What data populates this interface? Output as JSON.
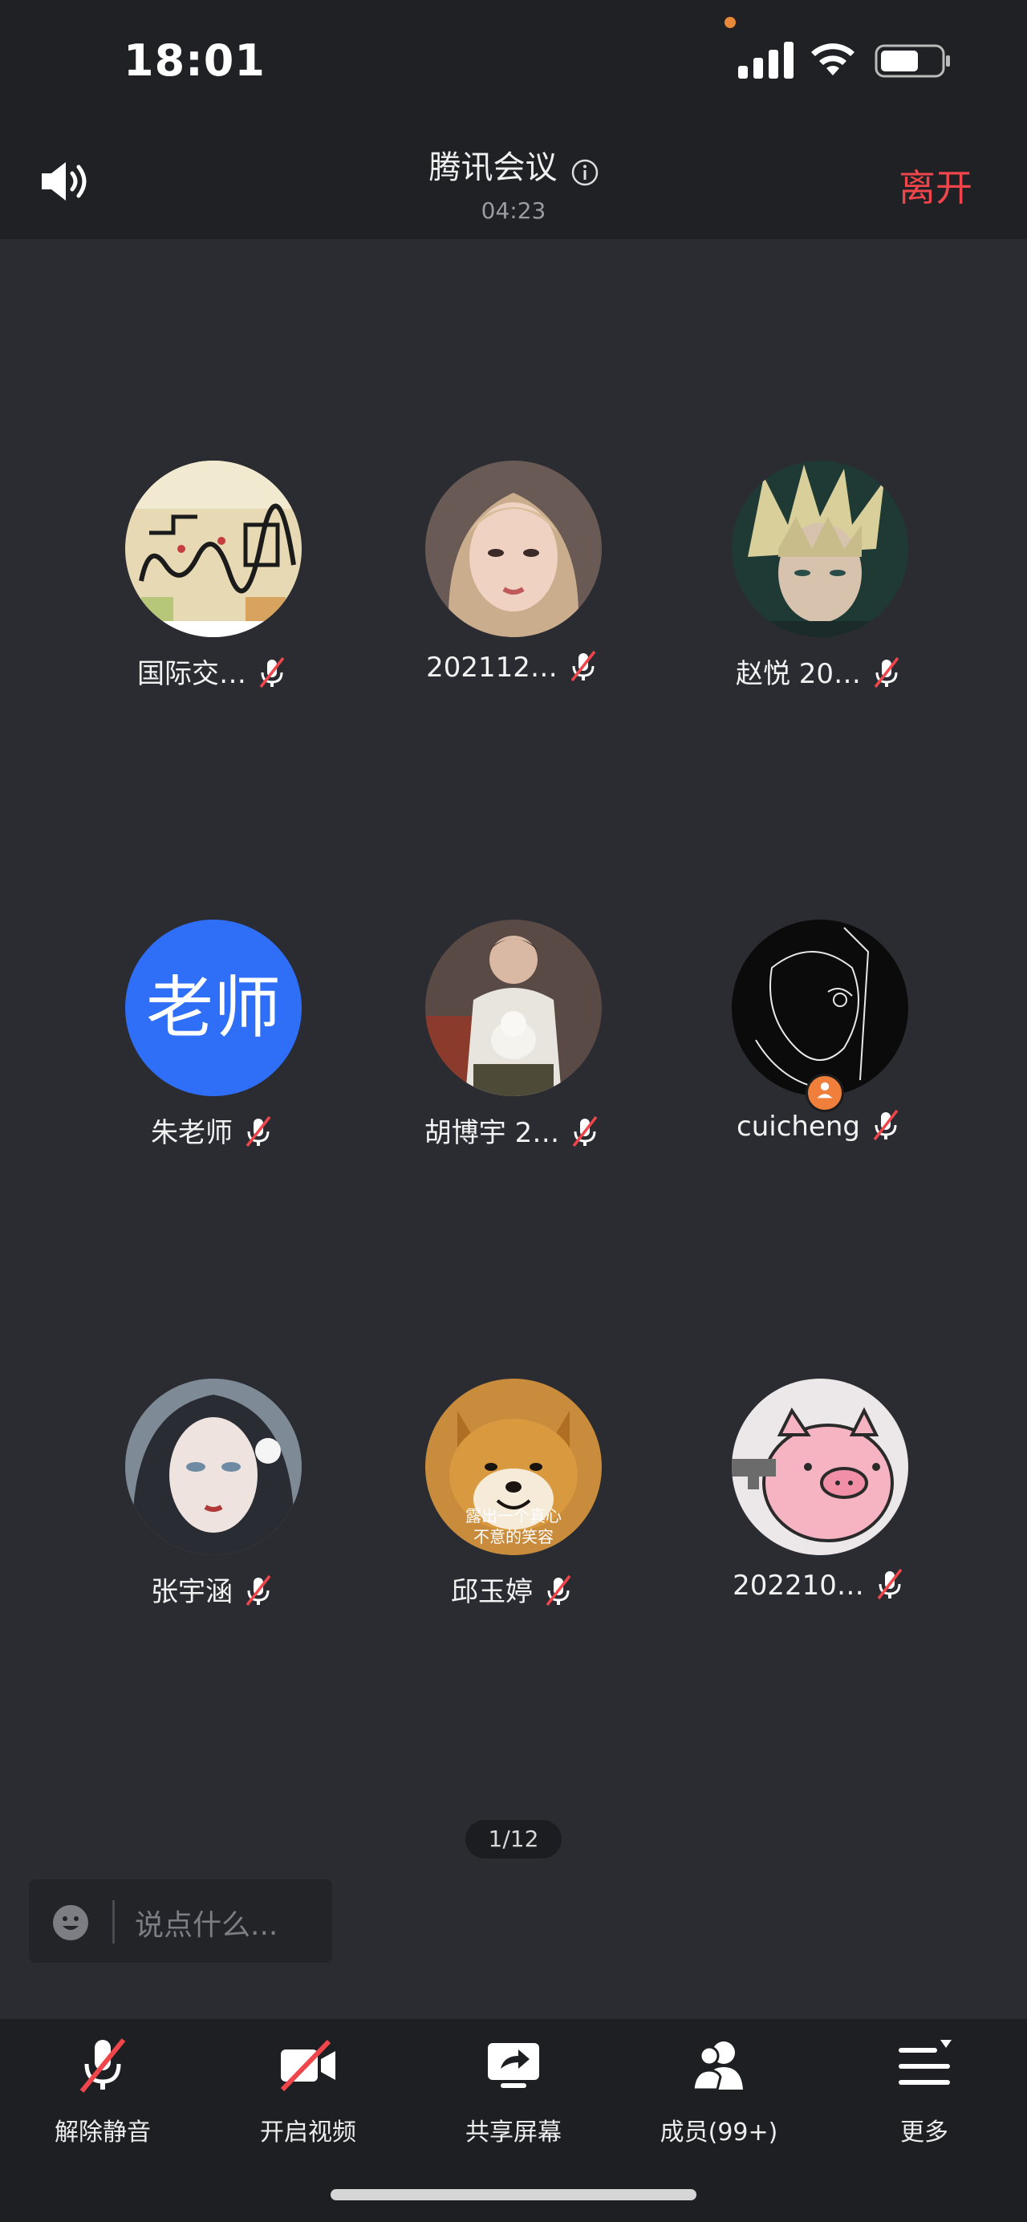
{
  "status_bar": {
    "time": "18:01"
  },
  "header": {
    "title": "腾讯会议",
    "duration": "04:23",
    "leave_label": "离开"
  },
  "participants": [
    {
      "name": "国际交…",
      "avatar": "abstract-painting-avatar",
      "muted": true
    },
    {
      "name": "202112…",
      "avatar": "portrait-photo-avatar",
      "muted": true
    },
    {
      "name": "赵悦 20…",
      "avatar": "game-character-avatar",
      "muted": true
    },
    {
      "name": "朱老师",
      "avatar_text": "老师",
      "avatar_color": "#2f6ef7",
      "muted": true
    },
    {
      "name": "胡博宇 2…",
      "avatar": "person-with-dog-avatar",
      "muted": true
    },
    {
      "name": "cuicheng",
      "avatar": "line-art-avatar",
      "muted": true,
      "is_host": true
    },
    {
      "name": "张宇涵",
      "avatar": "anime-girl-avatar",
      "muted": true
    },
    {
      "name": "邱玉婷",
      "avatar": "shiba-dog-avatar",
      "avatar_caption": "露出一个真心\n不意的笑容",
      "muted": true
    },
    {
      "name": "202210…",
      "avatar": "pink-pig-avatar",
      "muted": true
    }
  ],
  "pager": "1/12",
  "chat": {
    "placeholder": "说点什么..."
  },
  "toolbar": {
    "unmute_label": "解除静音",
    "video_label": "开启视频",
    "share_label": "共享屏幕",
    "members_label": "成员(99+)",
    "more_label": "更多"
  },
  "colors": {
    "leave": "#f0464b",
    "background": "#2b2c31",
    "host_badge": "#ef7f3b"
  }
}
